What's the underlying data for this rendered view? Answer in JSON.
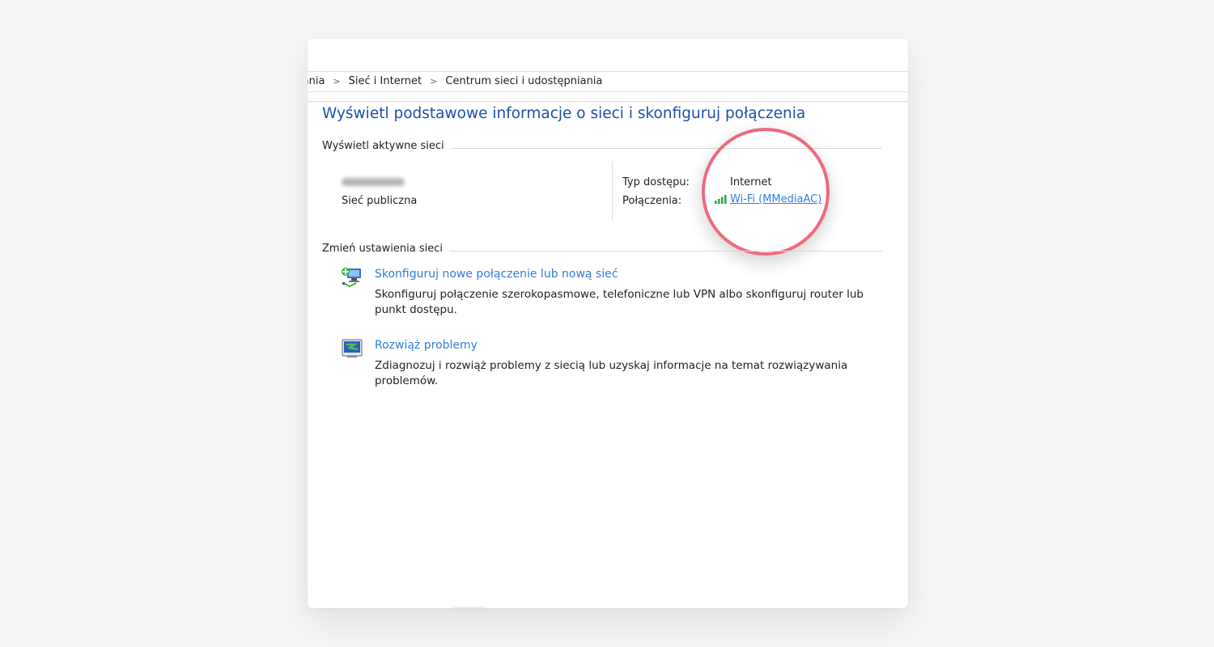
{
  "breadcrumb": {
    "items": [
      "wania",
      "Sieć i Internet",
      "Centrum sieci i udostępniania"
    ],
    "separator": ">"
  },
  "page_title": "Wyświetl podstawowe informacje o sieci i skonfiguruj połączenia",
  "active_networks": {
    "section_label": "Wyświetl aktywne sieci",
    "network_type": "Sieć publiczna",
    "access_type_label": "Typ dostępu:",
    "access_type_value": "Internet",
    "connections_label": "Połączenia:",
    "connection_link": "Wi-Fi (MMediaAC)"
  },
  "change_settings": {
    "section_label": "Zmień ustawienia sieci",
    "tasks": [
      {
        "icon": "new-connection-icon",
        "link": "Skonfiguruj nowe połączenie lub nową sieć",
        "description": "Skonfiguruj połączenie szerokopasmowe, telefoniczne lub VPN albo skonfiguruj router lub punkt dostępu."
      },
      {
        "icon": "troubleshoot-icon",
        "link": "Rozwiąż problemy",
        "description": "Zdiagnozuj i rozwiąż problemy z siecią lub uzyskaj informacje na temat rozwiązywania problemów."
      }
    ]
  },
  "colors": {
    "title": "#1f4fa8",
    "link": "#2f7fd6",
    "highlight": "#ee6a7f",
    "signal": "#2fa84f"
  }
}
